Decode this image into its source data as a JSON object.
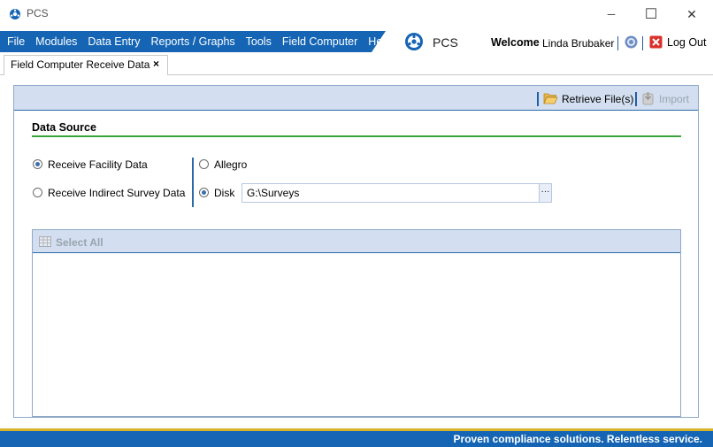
{
  "window": {
    "title": "PCS",
    "controls": {
      "minimize": "─",
      "maximize": "☐",
      "close": "✕"
    }
  },
  "menu": {
    "items": [
      "File",
      "Modules",
      "Data Entry",
      "Reports / Graphs",
      "Tools",
      "Field Computer",
      "Help"
    ]
  },
  "header": {
    "brand": "PCS",
    "welcome_label": "Welcome",
    "user_name": "Linda Brubaker",
    "logout_label": "Log Out"
  },
  "tabs": [
    {
      "label": "Field Computer Receive Data",
      "close": "×"
    }
  ],
  "toolbar": {
    "retrieve_label": "Retrieve File(s)",
    "import_label": "Import"
  },
  "data_source": {
    "title": "Data Source",
    "type_options": [
      {
        "label": "Receive Facility Data",
        "checked": true
      },
      {
        "label": "Receive Indirect Survey Data",
        "checked": false
      }
    ],
    "source_options": [
      {
        "label": "Allegro",
        "checked": false
      },
      {
        "label": "Disk",
        "checked": true
      }
    ],
    "path_value": "G:\\Surveys",
    "browse_label": "···"
  },
  "grid": {
    "select_all_label": "Select All"
  },
  "footer": {
    "slogan": "Proven compliance solutions.  Relentless service."
  },
  "colors": {
    "menu_blue": "#1565b4",
    "toolbar_bg": "#d3dff0",
    "section_green": "#3aa43a",
    "footer_gold": "#d9b32a"
  }
}
